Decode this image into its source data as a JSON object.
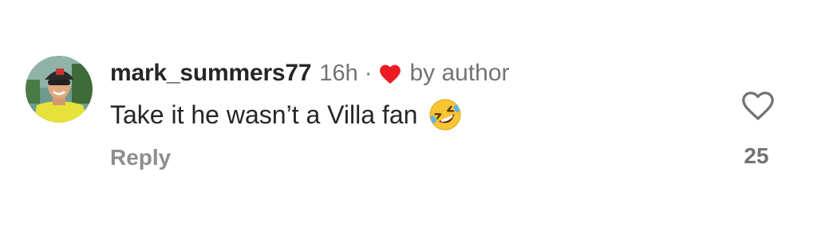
{
  "comment": {
    "username": "mark_summers77",
    "time": "16h",
    "separator": "·",
    "liked_by_label": "by author",
    "text": "Take it he wasn’t a Villa fan",
    "emoji": "rolling-on-the-floor-laughing",
    "reply_label": "Reply",
    "like_count": "25"
  },
  "icons": {
    "author_heart": "heart-filled-icon",
    "like": "heart-outline-icon"
  },
  "colors": {
    "author_heart": "#ed1c24",
    "username": "#262626",
    "secondary": "#737373"
  }
}
